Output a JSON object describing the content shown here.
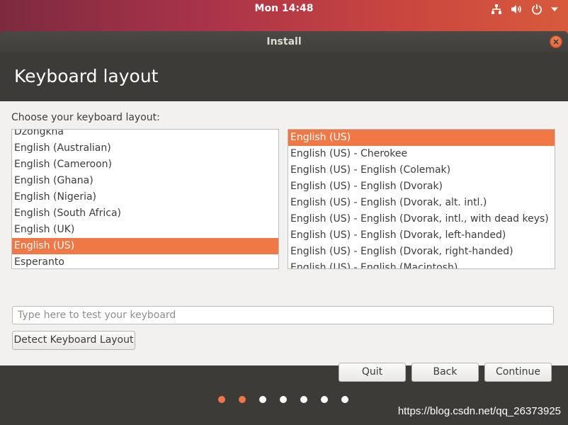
{
  "topbar": {
    "clock": "Mon 14:48",
    "icons": [
      "network-icon",
      "volume-icon",
      "power-icon",
      "chevron-down-icon"
    ]
  },
  "window": {
    "title": "Install",
    "header_title": "Keyboard layout"
  },
  "content": {
    "prompt": "Choose your keyboard layout:",
    "layouts": [
      {
        "label": "Dzongkha",
        "selected": false
      },
      {
        "label": "English (Australian)",
        "selected": false
      },
      {
        "label": "English (Cameroon)",
        "selected": false
      },
      {
        "label": "English (Ghana)",
        "selected": false
      },
      {
        "label": "English (Nigeria)",
        "selected": false
      },
      {
        "label": "English (South Africa)",
        "selected": false
      },
      {
        "label": "English (UK)",
        "selected": false
      },
      {
        "label": "English (US)",
        "selected": true
      },
      {
        "label": "Esperanto",
        "selected": false
      }
    ],
    "variants": [
      {
        "label": "English (US)",
        "selected": true
      },
      {
        "label": "English (US) - Cherokee",
        "selected": false
      },
      {
        "label": "English (US) - English (Colemak)",
        "selected": false
      },
      {
        "label": "English (US) - English (Dvorak)",
        "selected": false
      },
      {
        "label": "English (US) - English (Dvorak, alt. intl.)",
        "selected": false
      },
      {
        "label": "English (US) - English (Dvorak, intl., with dead keys)",
        "selected": false
      },
      {
        "label": "English (US) - English (Dvorak, left-handed)",
        "selected": false
      },
      {
        "label": "English (US) - English (Dvorak, right-handed)",
        "selected": false
      },
      {
        "label": "English (US) - English (Macintosh)",
        "selected": false
      }
    ],
    "test_input": {
      "value": "",
      "placeholder": "Type here to test your keyboard"
    },
    "detect_label": "Detect Keyboard Layout",
    "quit_label": "Quit",
    "back_label": "Back",
    "continue_label": "Continue"
  },
  "progress": {
    "total_steps": 7,
    "completed_steps": 2
  },
  "watermark": "https://blog.csdn.net/qq_26373925",
  "colors": {
    "accent": "#f07746",
    "window_bg": "#3c3b37",
    "content_bg": "#f2f1f0"
  }
}
